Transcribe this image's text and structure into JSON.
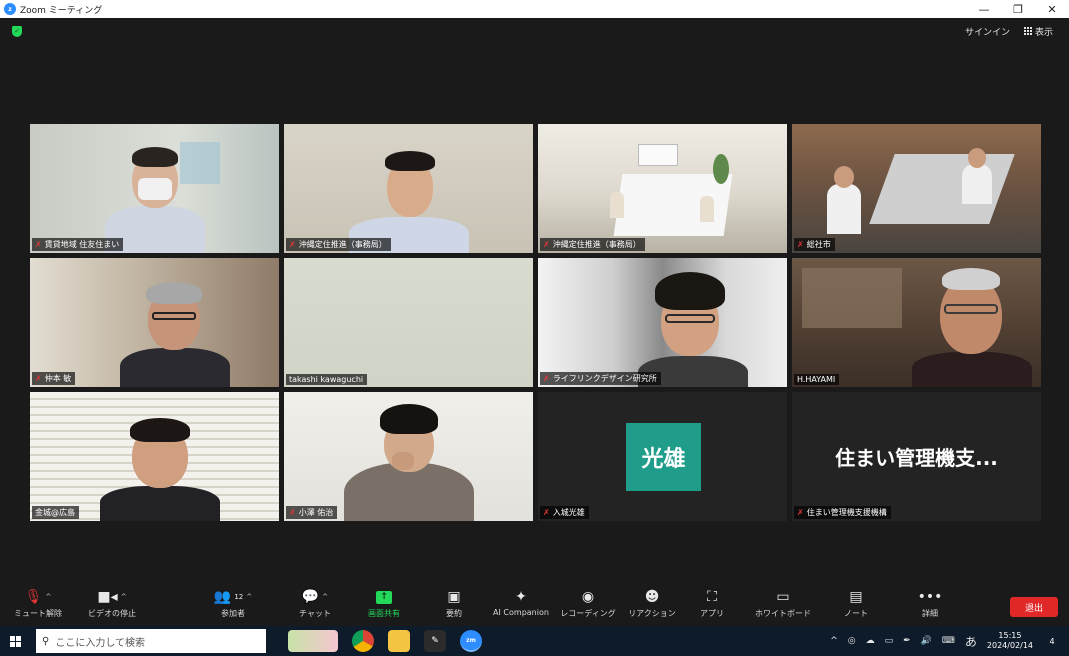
{
  "window": {
    "title": "Zoom ミーティング",
    "min_label": "—",
    "max_label": "❐",
    "close_label": "✕"
  },
  "header": {
    "signin_label": "サインイン",
    "view_label": "表示"
  },
  "participants": [
    {
      "name": "賃貸地域 住友住まい",
      "muted": true
    },
    {
      "name": "沖縄定住推進（事務局）",
      "muted": true
    },
    {
      "name": "沖縄定住推進（事務局）",
      "muted": true
    },
    {
      "name": "総社市",
      "muted": true
    },
    {
      "name": "仲本 敏",
      "muted": true
    },
    {
      "name": "takashi kawaguchi",
      "muted": false
    },
    {
      "name": "ライフリンクデザイン研究所",
      "muted": true
    },
    {
      "name": "H.HAYAMI",
      "muted": false,
      "active": true
    },
    {
      "name": "金城@広島",
      "muted": false
    },
    {
      "name": "小澤 佑治",
      "muted": true
    },
    {
      "name": "入城光雄",
      "muted": true,
      "avatar_text": "光雄"
    },
    {
      "name": "住まい管理機支援機構",
      "muted": true,
      "display_name_large": "住まい管理機支..."
    }
  ],
  "toolbar": {
    "mute": "ミュート解除",
    "video": "ビデオの停止",
    "participants": "参加者",
    "participant_count": "12",
    "chat": "チャット",
    "share": "画面共有",
    "summary": "要約",
    "ai": "AI Companion",
    "record": "レコーディング",
    "reactions": "リアクション",
    "apps": "アプリ",
    "whiteboard": "ホワイトボード",
    "notes": "ノート",
    "more": "詳細",
    "leave": "退出"
  },
  "taskbar": {
    "search_placeholder": "ここに入力して検索",
    "ime": "あ",
    "time": "15:15",
    "date": "2024/02/14",
    "notification_count": "4"
  },
  "colors": {
    "zoom_blue": "#2d8cff",
    "share_green": "#23d959",
    "leave_red": "#e02828",
    "active_speaker": "#e4e063",
    "avatar_teal": "#1f9d8a"
  }
}
